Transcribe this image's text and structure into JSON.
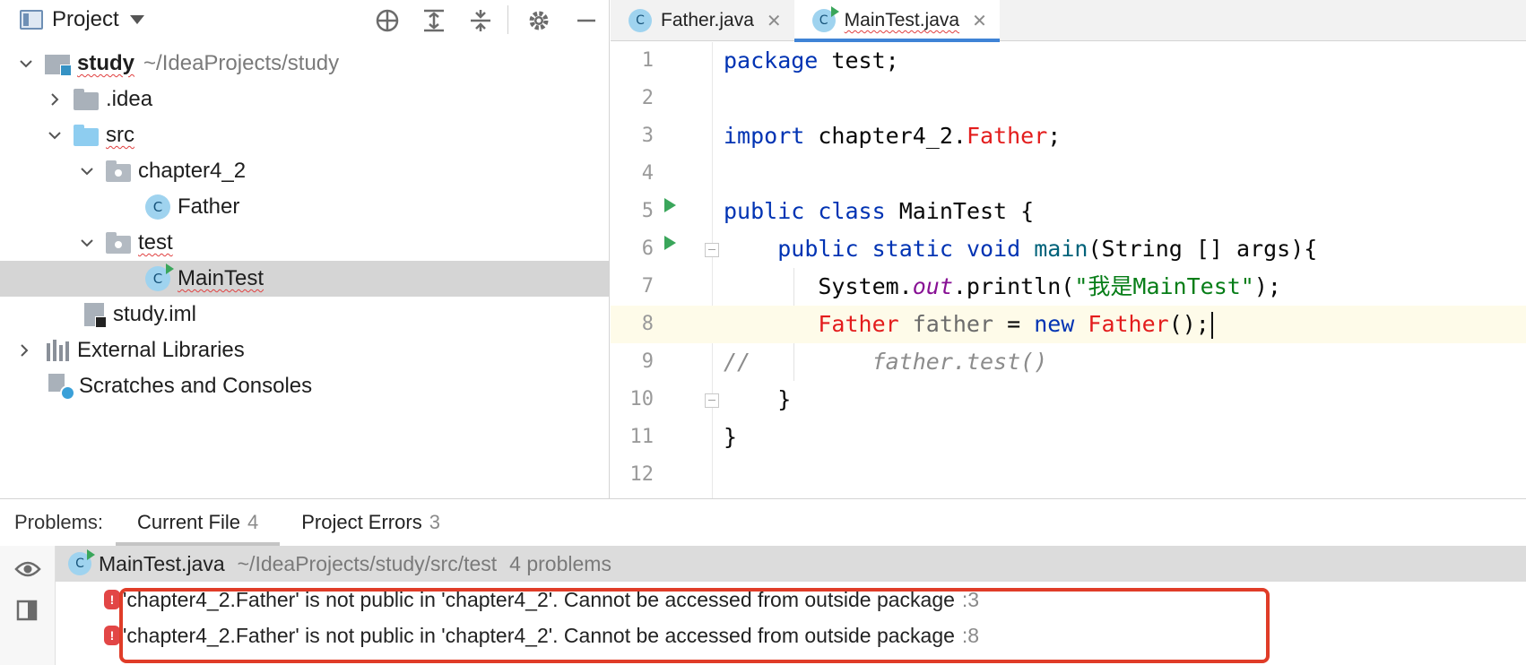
{
  "project_panel": {
    "title": "Project",
    "tree": {
      "root_name": "study",
      "root_path": "~/IdeaProjects/study",
      "idea": ".idea",
      "src": "src",
      "chapter": "chapter4_2",
      "father": "Father",
      "test": "test",
      "maintest": "MainTest",
      "iml": "study.iml",
      "libraries": "External Libraries",
      "scratches": "Scratches and Consoles"
    }
  },
  "editor": {
    "tabs": [
      {
        "label": "Father.java",
        "icon": "C"
      },
      {
        "label": "MainTest.java",
        "icon": "C"
      }
    ],
    "line_numbers": [
      "1",
      "2",
      "3",
      "4",
      "5",
      "6",
      "7",
      "8",
      "9",
      "10",
      "11",
      "12"
    ],
    "code": {
      "l1_kw": "package",
      "l1_rest": " test;",
      "l3_kw": "import",
      "l3_pkg": " chapter4_2.",
      "l3_err": "Father",
      "l3_end": ";",
      "l5_kw1": "public",
      "l5_kw2": "class",
      "l5_rest": " MainTest {",
      "l6_kw1": "public",
      "l6_kw2": "static",
      "l6_kw3": "void",
      "l6_fn": "main",
      "l6_rest": "(String [] args){",
      "l7_a": "System.",
      "l7_out": "out",
      "l7_b": ".println(",
      "l7_str": "\"我是MainTest\"",
      "l7_c": ");",
      "l8_err1": "Father",
      "l8_var": " father",
      "l8_eq": " = ",
      "l8_kw": "new",
      "l8_err2": " Father",
      "l8_end": "();",
      "l9_cmt": "//",
      "l9_code": "father.test()",
      "l10": "}",
      "l11": "}"
    }
  },
  "problems": {
    "label": "Problems:",
    "tabs": [
      {
        "label": "Current File",
        "count": "4"
      },
      {
        "label": "Project Errors",
        "count": "3"
      }
    ],
    "file": {
      "name": "MainTest.java",
      "path": "~/IdeaProjects/study/src/test",
      "count": "4 problems"
    },
    "items": [
      {
        "icon": "!",
        "text": "'chapter4_2.Father' is not public in 'chapter4_2'. Cannot be accessed from outside package",
        "line": ":3"
      },
      {
        "icon": "!",
        "text": "'chapter4_2.Father' is not public in 'chapter4_2'. Cannot be accessed from outside package",
        "line": ":8"
      }
    ]
  },
  "colors": {
    "keyword": "#0033b3",
    "error": "#e31c1c",
    "string": "#067d17",
    "highlight_box": "#e03c28",
    "tab_accent": "#3f83d6"
  }
}
